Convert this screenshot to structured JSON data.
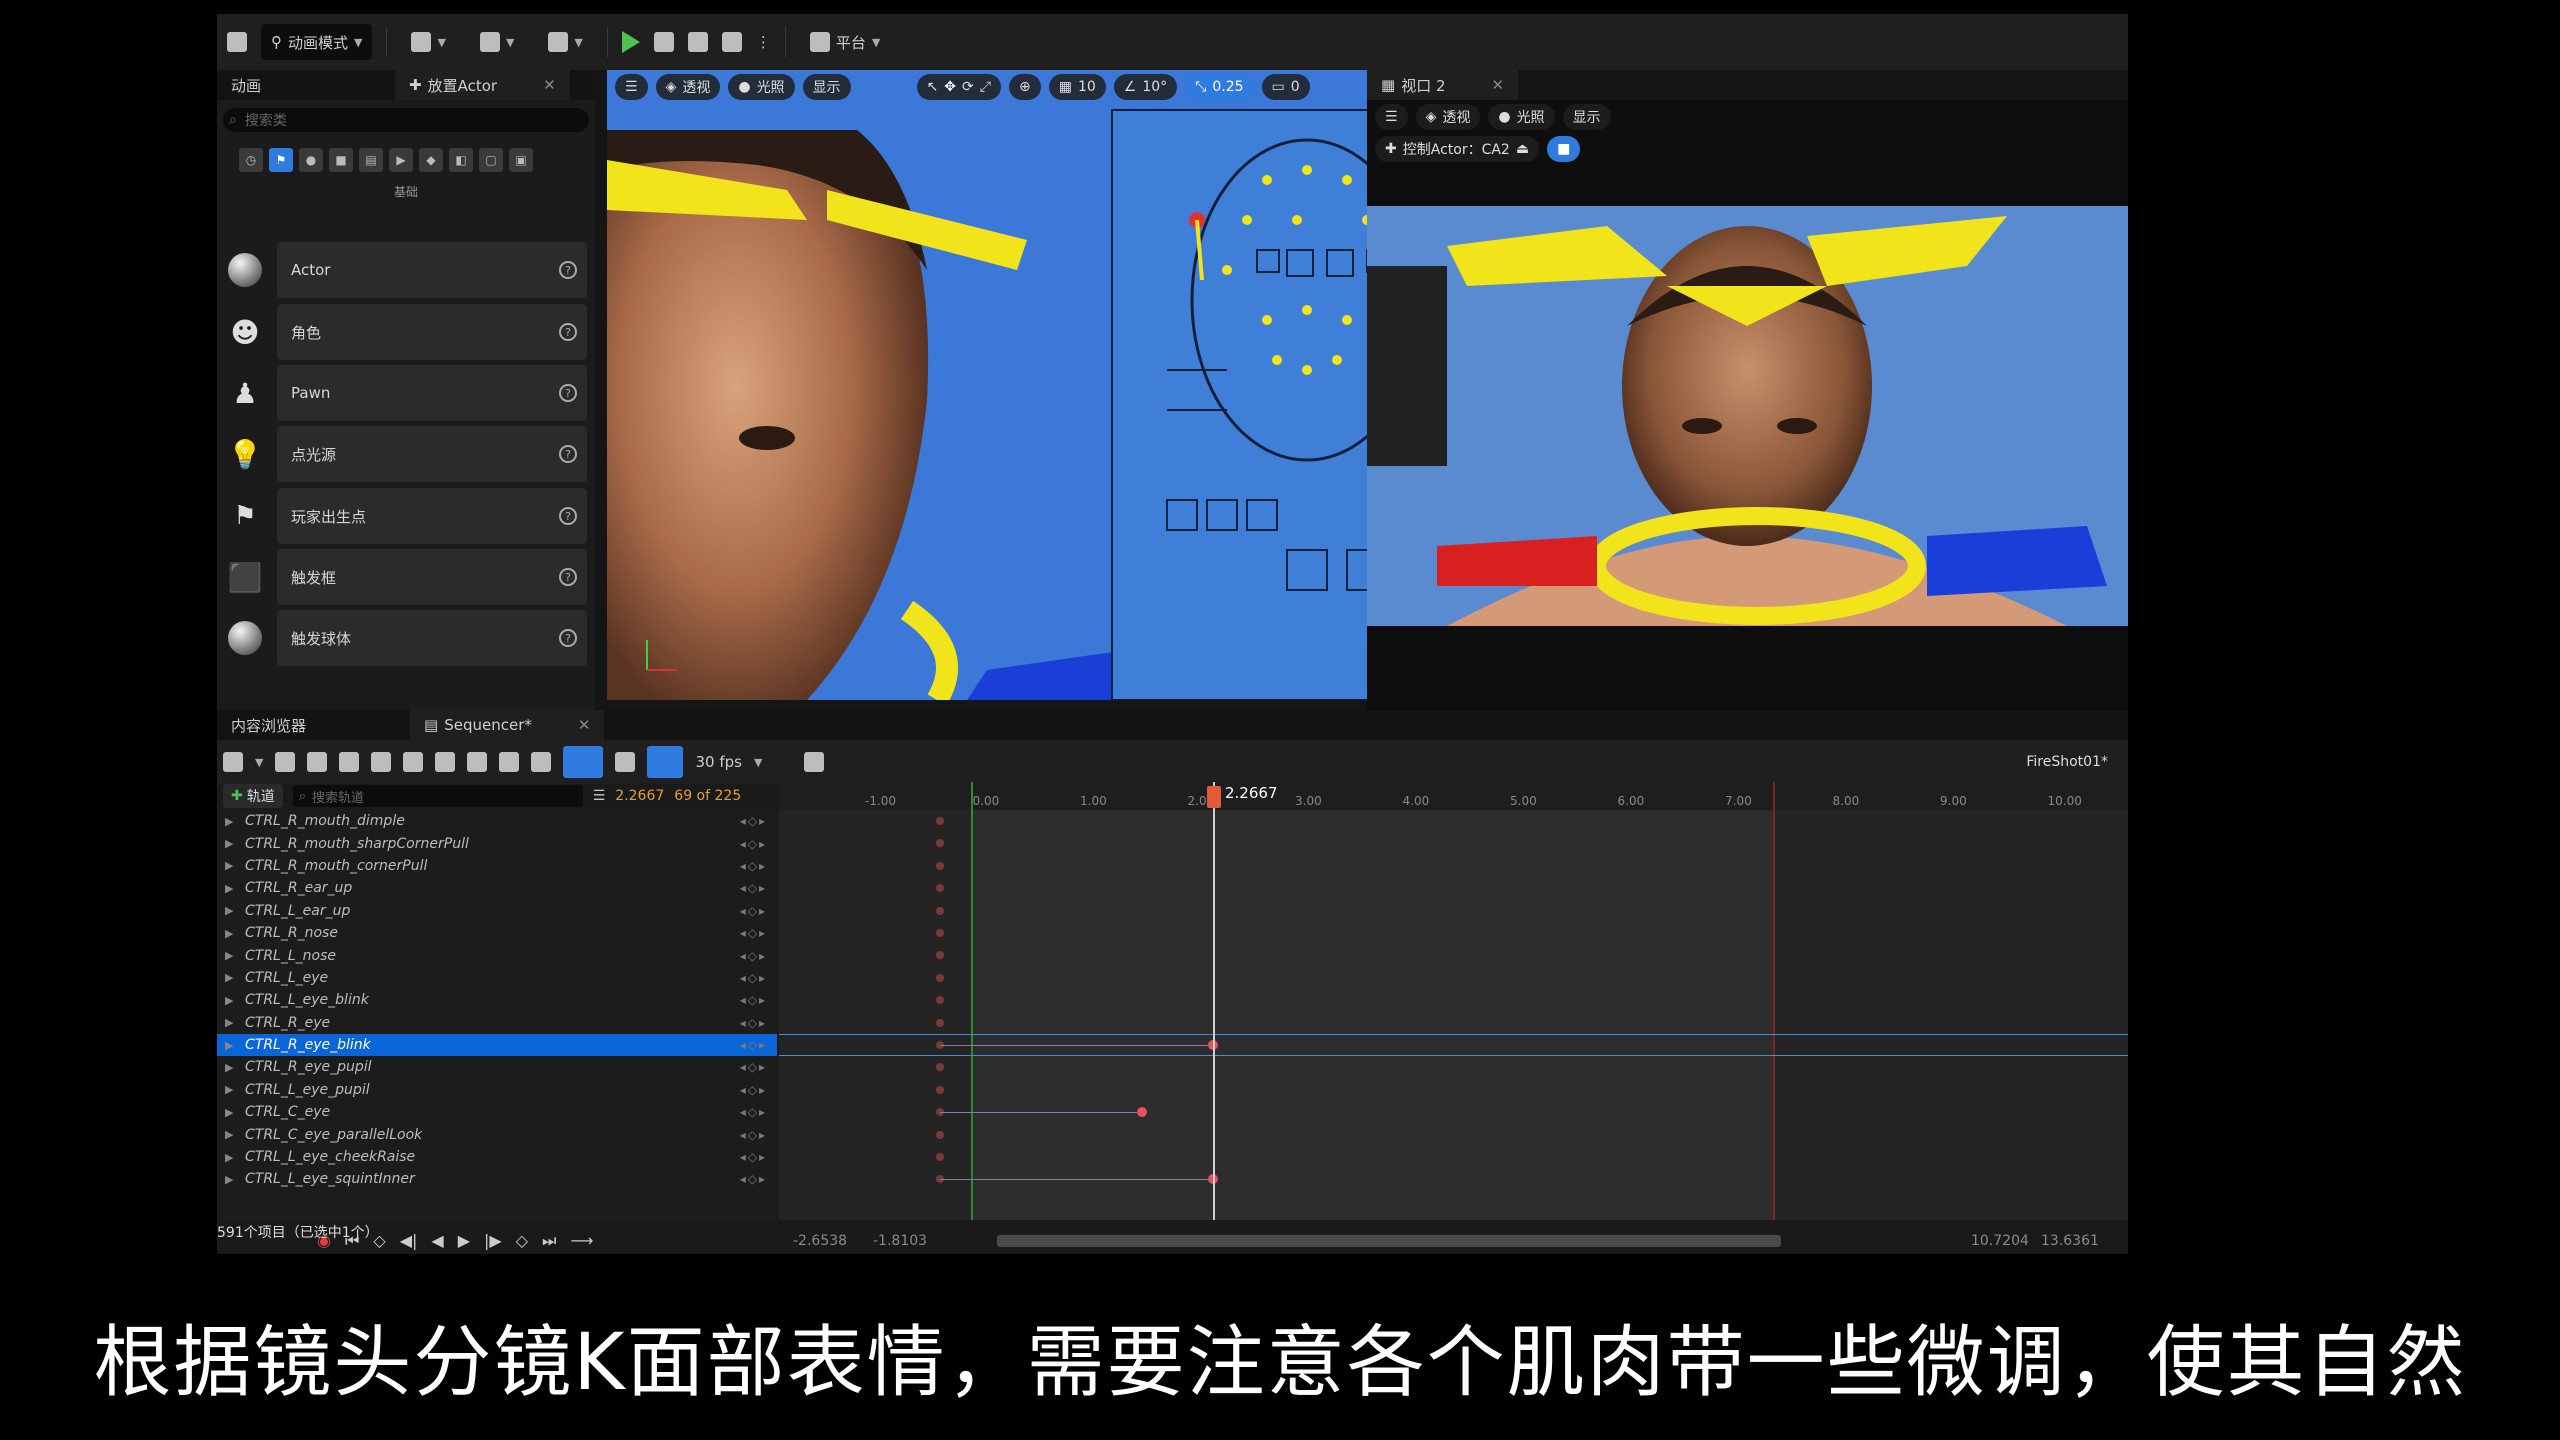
{
  "toolbar": {
    "mode": "动画模式",
    "platform": "平台"
  },
  "place_panel": {
    "tabs": [
      "动画",
      "放置Actor"
    ],
    "search_placeholder": "搜索类",
    "category_label": "基础",
    "items": [
      "Actor",
      "角色",
      "Pawn",
      "点光源",
      "玩家出生点",
      "触发框",
      "触发球体"
    ]
  },
  "viewport1": {
    "pills": [
      "透视",
      "光照",
      "显示"
    ],
    "grid": "10",
    "angle": "10°",
    "scale": "0.25",
    "camera_speed": "0"
  },
  "viewport2": {
    "tab": "视口 2",
    "pills": [
      "透视",
      "光照",
      "显示"
    ],
    "pilot": "控制Actor：CA2"
  },
  "sequencer": {
    "tabs": [
      "内容浏览器",
      "Sequencer*"
    ],
    "fps": "30 fps",
    "shot": "FireShot01*",
    "add_track": "轨道",
    "search_placeholder": "搜索轨道",
    "current_time": "2.2667",
    "frame_info": "69 of 225",
    "playhead_label": "2.2667",
    "ruler_ticks": [
      "-1.00",
      "0.00",
      "1.00",
      "2.00",
      "3.00",
      "4.00",
      "5.00",
      "6.00",
      "7.00",
      "8.00",
      "9.00",
      "10.00"
    ],
    "tracks": [
      "CTRL_R_mouth_dimple",
      "CTRL_R_mouth_sharpCornerPull",
      "CTRL_R_mouth_cornerPull",
      "CTRL_R_ear_up",
      "CTRL_L_ear_up",
      "CTRL_R_nose",
      "CTRL_L_nose",
      "CTRL_L_eye",
      "CTRL_L_eye_blink",
      "CTRL_R_eye",
      "CTRL_R_eye_blink",
      "CTRL_R_eye_pupil",
      "CTRL_L_eye_pupil",
      "CTRL_C_eye",
      "CTRL_C_eye_parallelLook",
      "CTRL_L_eye_cheekRaise",
      "CTRL_L_eye_squintInner"
    ],
    "selected_track": "CTRL_R_eye_blink",
    "item_count": "591个项目（已选中1个）",
    "transport_left": [
      "-2.6538",
      "-1.8103"
    ],
    "transport_right": [
      "10.7204",
      "13.6361"
    ]
  },
  "subtitle": "根据镜头分镜K面部表情，需要注意各个肌肉带一些微调，使其自然"
}
